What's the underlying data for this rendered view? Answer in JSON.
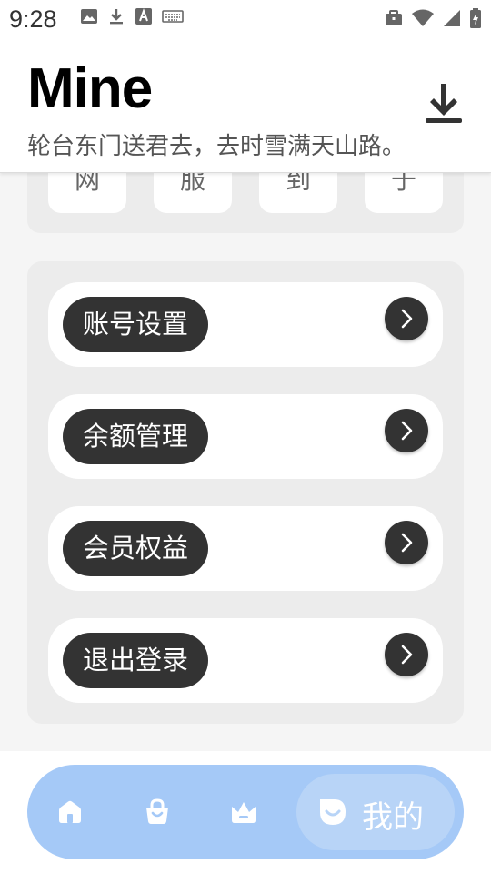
{
  "status_bar": {
    "time": "9:28",
    "left_icons": [
      "image-icon",
      "download-arrow-icon",
      "font-a-icon",
      "keyboard-icon"
    ],
    "right_icons": [
      "briefcase-icon",
      "wifi-icon",
      "cell-signal-icon",
      "battery-charging-icon"
    ]
  },
  "header": {
    "title": "Mine",
    "subtitle": "轮台东门送君去，去时雪满天山路。",
    "action_icon": "download-icon"
  },
  "grid": {
    "tiles": [
      {
        "char": "网"
      },
      {
        "char": "服"
      },
      {
        "char": "到"
      },
      {
        "char": "于"
      }
    ]
  },
  "menu": {
    "items": [
      {
        "label": "账号设置"
      },
      {
        "label": "余额管理"
      },
      {
        "label": "会员权益"
      },
      {
        "label": "退出登录"
      }
    ],
    "arrow_icon": "chevron-right-icon"
  },
  "bottom_nav": {
    "items": [
      {
        "icon": "home-icon"
      },
      {
        "icon": "shopping-bag-icon"
      },
      {
        "icon": "crown-icon"
      }
    ],
    "active": {
      "icon": "profile-icon",
      "label": "我的"
    }
  },
  "colors": {
    "accent_nav": "#a5c9f7",
    "pill": "#333333",
    "card": "#ececec"
  }
}
